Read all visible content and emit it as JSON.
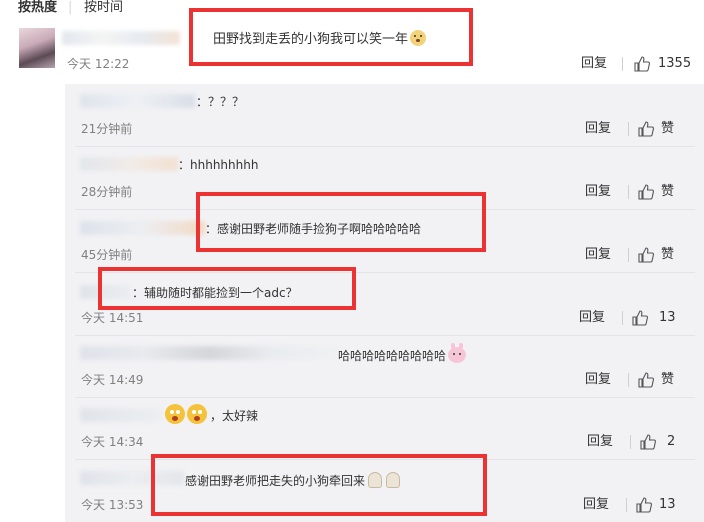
{
  "sort": {
    "hot": "按热度",
    "sep": "|",
    "time": "按时间"
  },
  "main_comment": {
    "text": "田野找到走丢的小狗我可以笑一年",
    "time": "今天 12:22",
    "reply": "回复",
    "likes": "1355"
  },
  "replies": [
    {
      "text": "：？？？",
      "time": "21分钟前",
      "reply": "回复",
      "like": "赞"
    },
    {
      "text": "：hhhhhhhhh",
      "time": "28分钟前",
      "reply": "回复",
      "like": "赞"
    },
    {
      "text": "：感谢田野老师随手捡狗子啊哈哈哈哈哈",
      "time": "45分钟前",
      "reply": "回复",
      "like": "赞"
    },
    {
      "text": "：辅助随时都能捡到一个adc？",
      "time": "今天 14:51",
      "reply": "回复",
      "like": "13"
    },
    {
      "text": "哈哈哈哈哈哈哈哈哈",
      "time": "今天 14:49",
      "reply": "回复",
      "like": "赞"
    },
    {
      "text": "，太好辣",
      "time": "今天 14:34",
      "reply": "回复",
      "like": "2"
    },
    {
      "text": "感谢田野老师把走失的小狗牵回来",
      "time": "今天 13:53",
      "reply": "回复",
      "like": "13"
    }
  ],
  "colors": {
    "highlight": "#ec3334",
    "reply_bg": "#f2f2f5",
    "meta": "#808080"
  }
}
